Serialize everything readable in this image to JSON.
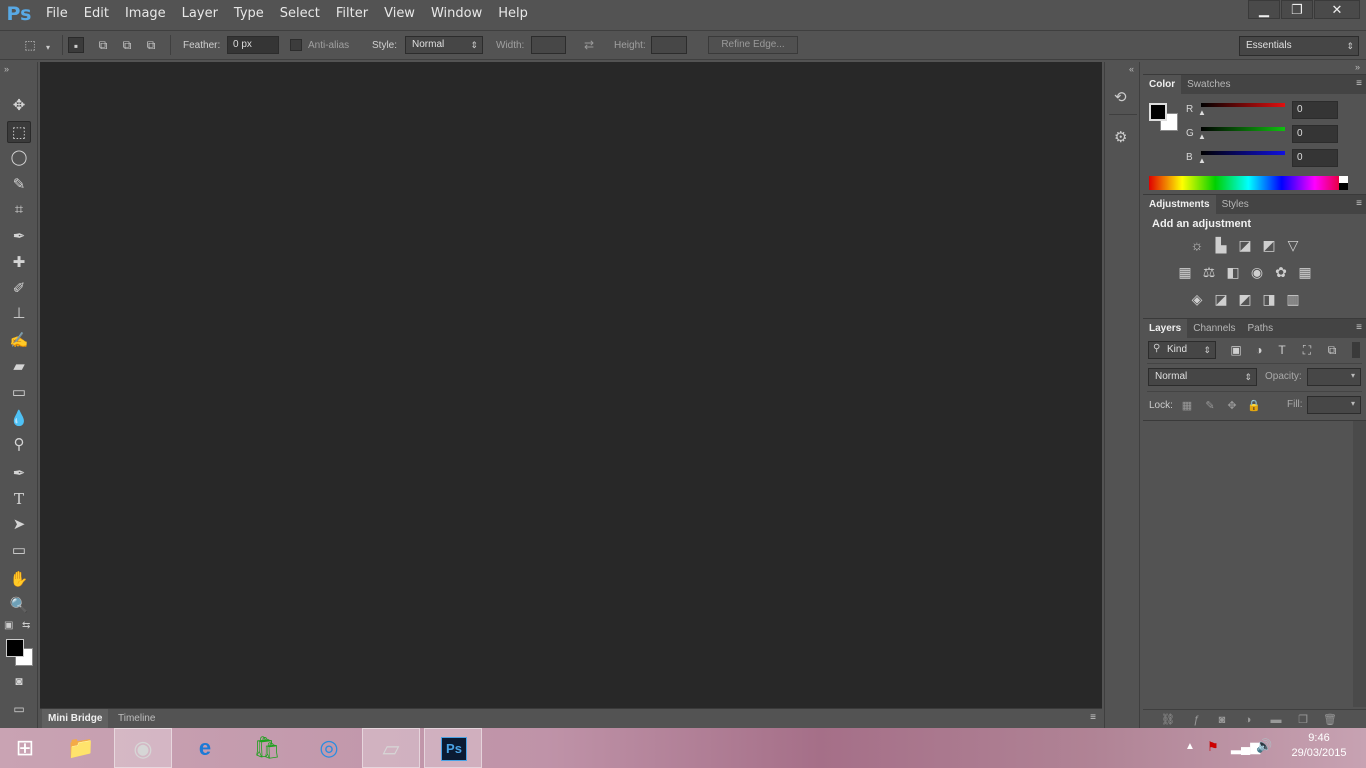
{
  "app": {
    "logo": "Ps"
  },
  "menu": [
    "File",
    "Edit",
    "Image",
    "Layer",
    "Type",
    "Select",
    "Filter",
    "View",
    "Window",
    "Help"
  ],
  "window_controls": {
    "minimize": "▁",
    "restore": "❐",
    "close": "✕"
  },
  "options": {
    "feather_label": "Feather:",
    "feather_value": "0 px",
    "antialias_label": "Anti-alias",
    "style_label": "Style:",
    "style_value": "Normal",
    "width_label": "Width:",
    "height_label": "Height:",
    "refine_label": "Refine Edge...",
    "workspace": "Essentials"
  },
  "tools": [
    {
      "name": "move-tool-icon",
      "glyph": "✥"
    },
    {
      "name": "marquee-tool-icon",
      "glyph": "⬚"
    },
    {
      "name": "lasso-tool-icon",
      "glyph": "◯"
    },
    {
      "name": "quick-select-tool-icon",
      "glyph": "✎"
    },
    {
      "name": "crop-tool-icon",
      "glyph": "⌗"
    },
    {
      "name": "eyedropper-tool-icon",
      "glyph": "✒"
    },
    {
      "name": "healing-tool-icon",
      "glyph": "✚"
    },
    {
      "name": "brush-tool-icon",
      "glyph": "✐"
    },
    {
      "name": "stamp-tool-icon",
      "glyph": "⊥"
    },
    {
      "name": "history-brush-tool-icon",
      "glyph": "✍"
    },
    {
      "name": "eraser-tool-icon",
      "glyph": "▰"
    },
    {
      "name": "gradient-tool-icon",
      "glyph": "▭"
    },
    {
      "name": "blur-tool-icon",
      "glyph": "💧"
    },
    {
      "name": "dodge-tool-icon",
      "glyph": "⚲"
    },
    {
      "name": "pen-tool-icon",
      "glyph": "✒"
    },
    {
      "name": "type-tool-icon",
      "glyph": "T"
    },
    {
      "name": "path-select-tool-icon",
      "glyph": "➤"
    },
    {
      "name": "shape-tool-icon",
      "glyph": "▭"
    },
    {
      "name": "hand-tool-icon",
      "glyph": "✋"
    },
    {
      "name": "zoom-tool-icon",
      "glyph": "🔍"
    }
  ],
  "bottom_tabs": [
    "Mini Bridge",
    "Timeline"
  ],
  "color_panel": {
    "tabs": [
      "Color",
      "Swatches"
    ],
    "r_label": "R",
    "g_label": "G",
    "b_label": "B",
    "r": "0",
    "g": "0",
    "b": "0",
    "r_color": "#e01010",
    "g_color": "#10c010",
    "b_color": "#1010e0"
  },
  "adjust_panel": {
    "tabs": [
      "Adjustments",
      "Styles"
    ],
    "heading": "Add an adjustment",
    "icons": [
      [
        "brightness-icon",
        "levels-icon",
        "curves-icon",
        "exposure-icon",
        "vibrance-icon"
      ],
      [
        "hue-sat-icon",
        "color-balance-icon",
        "black-white-icon",
        "photo-filter-icon",
        "channel-mixer-icon",
        "color-lookup-icon"
      ],
      [
        "invert-icon",
        "posterize-icon",
        "threshold-icon",
        "selective-color-icon",
        "gradient-map-icon"
      ]
    ],
    "glyphs": [
      [
        "☼",
        "▙",
        "◪",
        "◩",
        "▽"
      ],
      [
        "▦",
        "⚖",
        "◧",
        "◉",
        "✿",
        "▦"
      ],
      [
        "◈",
        "◪",
        "◩",
        "◨",
        "▥"
      ]
    ]
  },
  "layers_panel": {
    "tabs": [
      "Layers",
      "Channels",
      "Paths"
    ],
    "kind": "Kind",
    "blend": "Normal",
    "opacity_label": "Opacity:",
    "lock_label": "Lock:",
    "fill_label": "Fill:"
  },
  "clock": {
    "time": "9:46",
    "date": "29/03/2015"
  }
}
